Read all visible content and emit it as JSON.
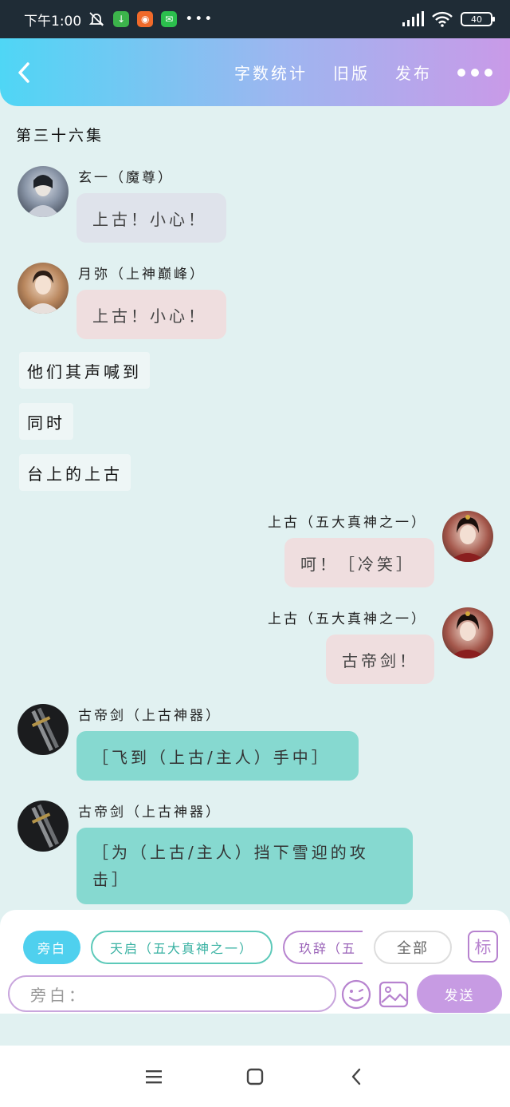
{
  "status_bar": {
    "time": "下午1:00",
    "battery": "40"
  },
  "header": {
    "actions": [
      "字数统计",
      "旧版",
      "发布"
    ]
  },
  "episode_title": "第三十六集",
  "messages": [
    {
      "sender": "玄一（魔尊）",
      "text": "上古！小心！"
    },
    {
      "sender": "月弥（上神巅峰）",
      "text": "上古！小心！"
    },
    {
      "text": "他们其声喊到"
    },
    {
      "text": "同时"
    },
    {
      "text": "台上的上古"
    },
    {
      "sender": "上古（五大真神之一）",
      "text": "呵！［冷笑］"
    },
    {
      "sender": "上古（五大真神之一）",
      "text": "古帝剑！"
    },
    {
      "sender": "古帝剑（上古神器）",
      "text": "［飞到（上古/主人）手中］"
    },
    {
      "sender": "古帝剑（上古神器）",
      "text": "［为（上古/主人）挡下雪迎的攻击］"
    }
  ],
  "role_chips": [
    "旁白",
    "天启（五大真神之一）",
    "玖辞（五",
    "全部"
  ],
  "tag_label": "标",
  "input": {
    "placeholder": "旁白："
  },
  "send_label": "发送",
  "colors": {
    "header_start": "#4fd6f5",
    "header_end": "#c99ae8",
    "teal_bubble": "#86d9d0",
    "pink_bubble": "#efdedf",
    "send": "#c79be3"
  }
}
